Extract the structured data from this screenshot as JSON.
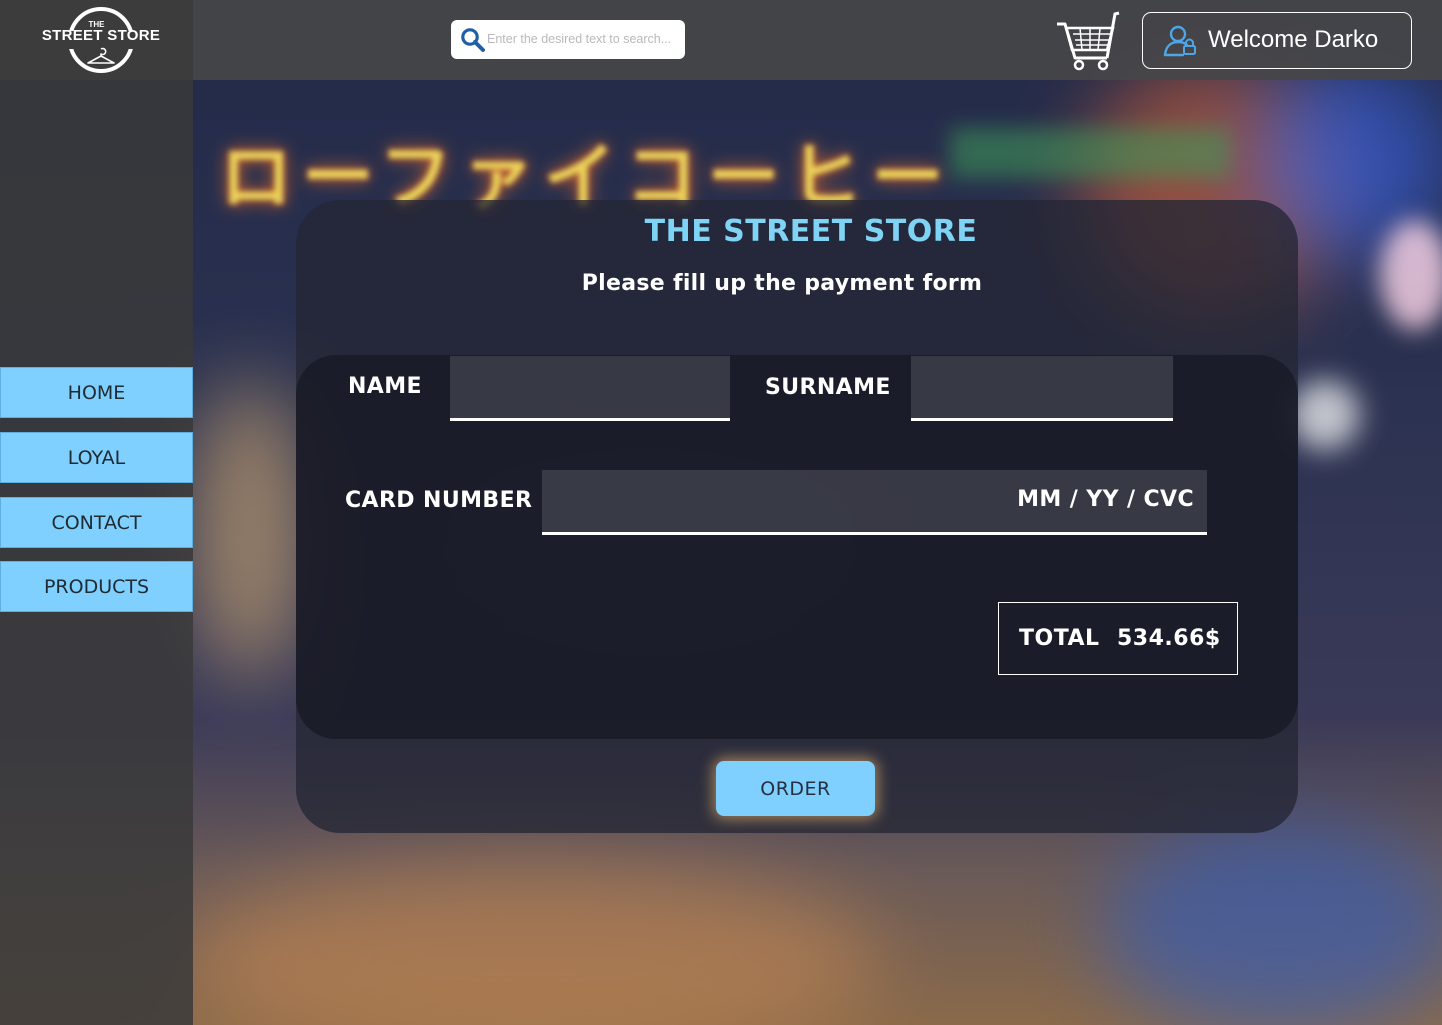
{
  "header": {
    "logo": {
      "small": "THE",
      "main": "STREET STORE"
    },
    "search": {
      "placeholder": "Enter the desired text to search...",
      "value": ""
    },
    "welcome_text": "Welcome Darko"
  },
  "sidebar": {
    "items": [
      {
        "label": "HOME"
      },
      {
        "label": "LOYAL"
      },
      {
        "label": "CONTACT"
      },
      {
        "label": "PRODUCTS"
      }
    ]
  },
  "background": {
    "sign_text": "ローファイコーヒー"
  },
  "payment": {
    "title": "THE STREET STORE",
    "subtitle": "Please fill up the payment form",
    "name_label": "NAME",
    "name_value": "",
    "surname_label": "SURNAME",
    "surname_value": "",
    "card_label": "CARD NUMBER",
    "card_value": "",
    "expiry_label": "MM / YY / CVC",
    "total_label": "TOTAL",
    "total_value": "534.66$",
    "order_label": "ORDER"
  },
  "colors": {
    "accent": "#7fd0ff",
    "title": "#7fd4f5",
    "topbar": "#464648",
    "sidebar": "#3a3a3a"
  },
  "icons": {
    "search": "search-icon",
    "cart": "cart-icon",
    "user": "user-icon",
    "logo": "hanger-icon"
  }
}
